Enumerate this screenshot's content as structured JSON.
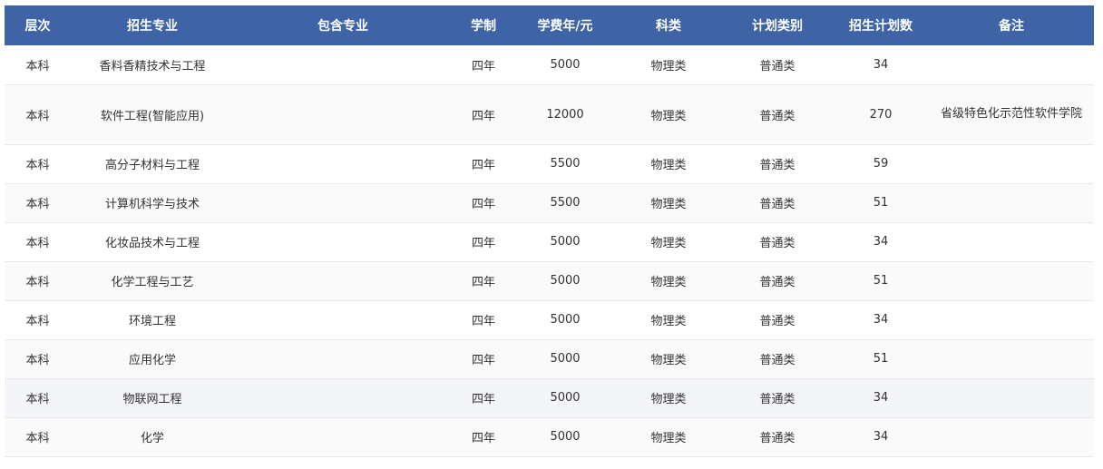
{
  "table": {
    "headers": [
      "层次",
      "招生专业",
      "包含专业",
      "学制",
      "学费年/元",
      "科类",
      "计划类别",
      "招生计划数",
      "备注"
    ],
    "rows": [
      [
        "本科",
        "香料香精技术与工程",
        "",
        "四年",
        "5000",
        "物理类",
        "普通类",
        "34",
        ""
      ],
      [
        "本科",
        "软件工程(智能应用)",
        "",
        "四年",
        "12000",
        "物理类",
        "普通类",
        "270",
        "省级特色化示范性软件学院"
      ],
      [
        "本科",
        "高分子材料与工程",
        "",
        "四年",
        "5500",
        "物理类",
        "普通类",
        "59",
        ""
      ],
      [
        "本科",
        "计算机科学与技术",
        "",
        "四年",
        "5500",
        "物理类",
        "普通类",
        "51",
        ""
      ],
      [
        "本科",
        "化妆品技术与工程",
        "",
        "四年",
        "5000",
        "物理类",
        "普通类",
        "34",
        ""
      ],
      [
        "本科",
        "化学工程与工艺",
        "",
        "四年",
        "5000",
        "物理类",
        "普通类",
        "51",
        ""
      ],
      [
        "本科",
        "环境工程",
        "",
        "四年",
        "5000",
        "物理类",
        "普通类",
        "34",
        ""
      ],
      [
        "本科",
        "应用化学",
        "",
        "四年",
        "5000",
        "物理类",
        "普通类",
        "51",
        ""
      ],
      [
        "本科",
        "物联网工程",
        "",
        "四年",
        "5000",
        "物理类",
        "普通类",
        "34",
        ""
      ],
      [
        "本科",
        "化学",
        "",
        "四年",
        "5000",
        "物理类",
        "普通类",
        "34",
        ""
      ]
    ]
  },
  "colors": {
    "header_bg": "#3f64a6",
    "header_text": "#ffffff",
    "row_alt": "#fafafa",
    "row_hover": "#f3f5f9"
  }
}
